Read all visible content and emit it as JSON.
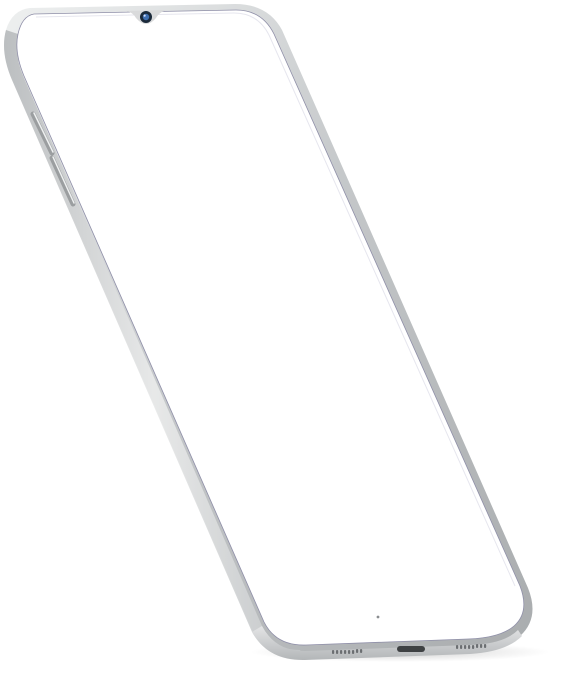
{
  "device": {
    "kind": "smartphone mockup",
    "screen": {
      "content": "blank",
      "color": "#ffffff"
    },
    "frame": {
      "color": "#c9cbcc",
      "edge_highlight": "#f2f3f3",
      "edge_shadow": "#9ea1a3"
    },
    "notch": {
      "style": "waterdrop",
      "camera_color": "#1b2a3a",
      "lens_color": "#3f6fb0"
    },
    "side_buttons": [
      "volume-up",
      "volume-down"
    ],
    "bottom_ports": [
      "speaker-grille-left",
      "usb-c-port",
      "speaker-grille-right"
    ]
  }
}
